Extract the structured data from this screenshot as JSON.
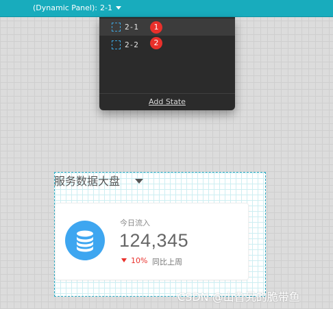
{
  "topbar": {
    "panel_label": "(Dynamic Panel):",
    "current_state": "2-1",
    "color": "#18acbd"
  },
  "dropdown": {
    "states": [
      {
        "name": "2-1",
        "badge": "1",
        "selected": true
      },
      {
        "name": "2-2",
        "badge": "2",
        "selected": false
      }
    ],
    "add_state_label": "Add State"
  },
  "dashboard": {
    "title": "服务数据大盘",
    "card": {
      "label": "今日流入",
      "value": "124,345",
      "trend_percent": "10%",
      "trend_direction": "down",
      "trend_label": "同比上周",
      "icon": "database-icon",
      "icon_color": "#3ea6f0",
      "trend_color": "#e9302b"
    }
  },
  "watermark": "CSDN @山旮旯的脆带鱼"
}
